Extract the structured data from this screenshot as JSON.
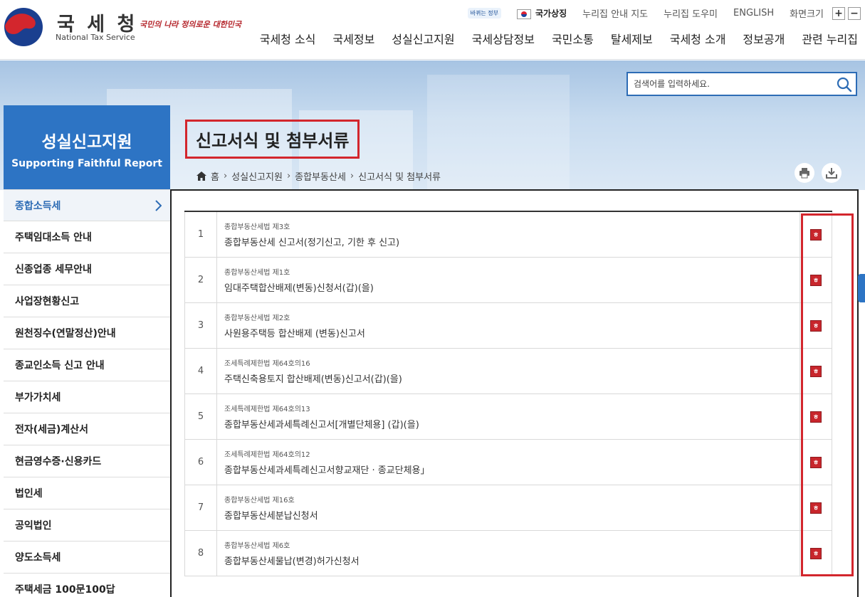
{
  "header": {
    "logo_ko": "국 세 청",
    "logo_en": "National Tax Service",
    "slogan": "국민의 나라 정의로운 대한민국",
    "util": {
      "gov_badge": "바뀌는 정부",
      "national_symbol": "국가상징",
      "sitemap": "누리집 안내 지도",
      "help": "누리집 도우미",
      "english": "ENGLISH",
      "zoom_label": "화면크기",
      "zoom_in": "+",
      "zoom_out": "−"
    },
    "gnb": [
      "국세청 소식",
      "국세정보",
      "성실신고지원",
      "국세상담정보",
      "국민소통",
      "탈세제보",
      "국세청 소개",
      "정보공개",
      "관련 누리집"
    ]
  },
  "search": {
    "placeholder": "검색어를 입력하세요."
  },
  "lnb": {
    "title_ko": "성실신고지원",
    "title_en": "Supporting Faithful Report",
    "items": [
      {
        "label": "종합소득세",
        "active": true
      },
      {
        "label": "주택임대소득 안내"
      },
      {
        "label": "신종업종 세무안내"
      },
      {
        "label": "사업장현황신고"
      },
      {
        "label": "원천징수(연말정산)안내"
      },
      {
        "label": "종교인소득 신고 안내"
      },
      {
        "label": "부가가치세"
      },
      {
        "label": "전자(세금)계산서"
      },
      {
        "label": "현금영수증·신용카드"
      },
      {
        "label": "법인세"
      },
      {
        "label": "공익법인"
      },
      {
        "label": "양도소득세"
      },
      {
        "label": "주택세금 100문100답"
      }
    ]
  },
  "page": {
    "title": "신고서식 및 첨부서류",
    "breadcrumb": [
      "홈",
      "성실신고지원",
      "종합부동산세",
      "신고서식 및 첨부서류"
    ]
  },
  "forms": [
    {
      "num": "1",
      "law": "종합부동산세법 제3호",
      "name": "종합부동산세 신고서(정기신고, 기한 후 신고)"
    },
    {
      "num": "2",
      "law": "종합부동산세법 제1호",
      "name": "임대주택합산배제(변동)신청서(갑)(을)"
    },
    {
      "num": "3",
      "law": "종합부동산세법 제2호",
      "name": "사원용주택등 합산배제 (변동)신고서"
    },
    {
      "num": "4",
      "law": "조세특례제한법 제64호의16",
      "name": "주택신축용토지 합산배제(변동)신고서(갑)(을)"
    },
    {
      "num": "5",
      "law": "조세특례제한법 제64호의13",
      "name": "종합부동산세과세특례신고서[개별단체용] (갑)(을)"
    },
    {
      "num": "6",
      "law": "조세특례제한법 제64호의12",
      "name": "종합부동산세과세특례신고서향교재단 · 종교단체용」"
    },
    {
      "num": "7",
      "law": "종합부동산세법 제16호",
      "name": "종합부동산세분납신청서"
    },
    {
      "num": "8",
      "law": "종합부동산세법 제6호",
      "name": "종합부동산세물납(변경)허가신청서"
    }
  ],
  "file_icon": "hwp-file-icon",
  "colors": {
    "brand_blue": "#2d74c4",
    "highlight_red": "#d3262d",
    "file_red": "#c8262c"
  }
}
